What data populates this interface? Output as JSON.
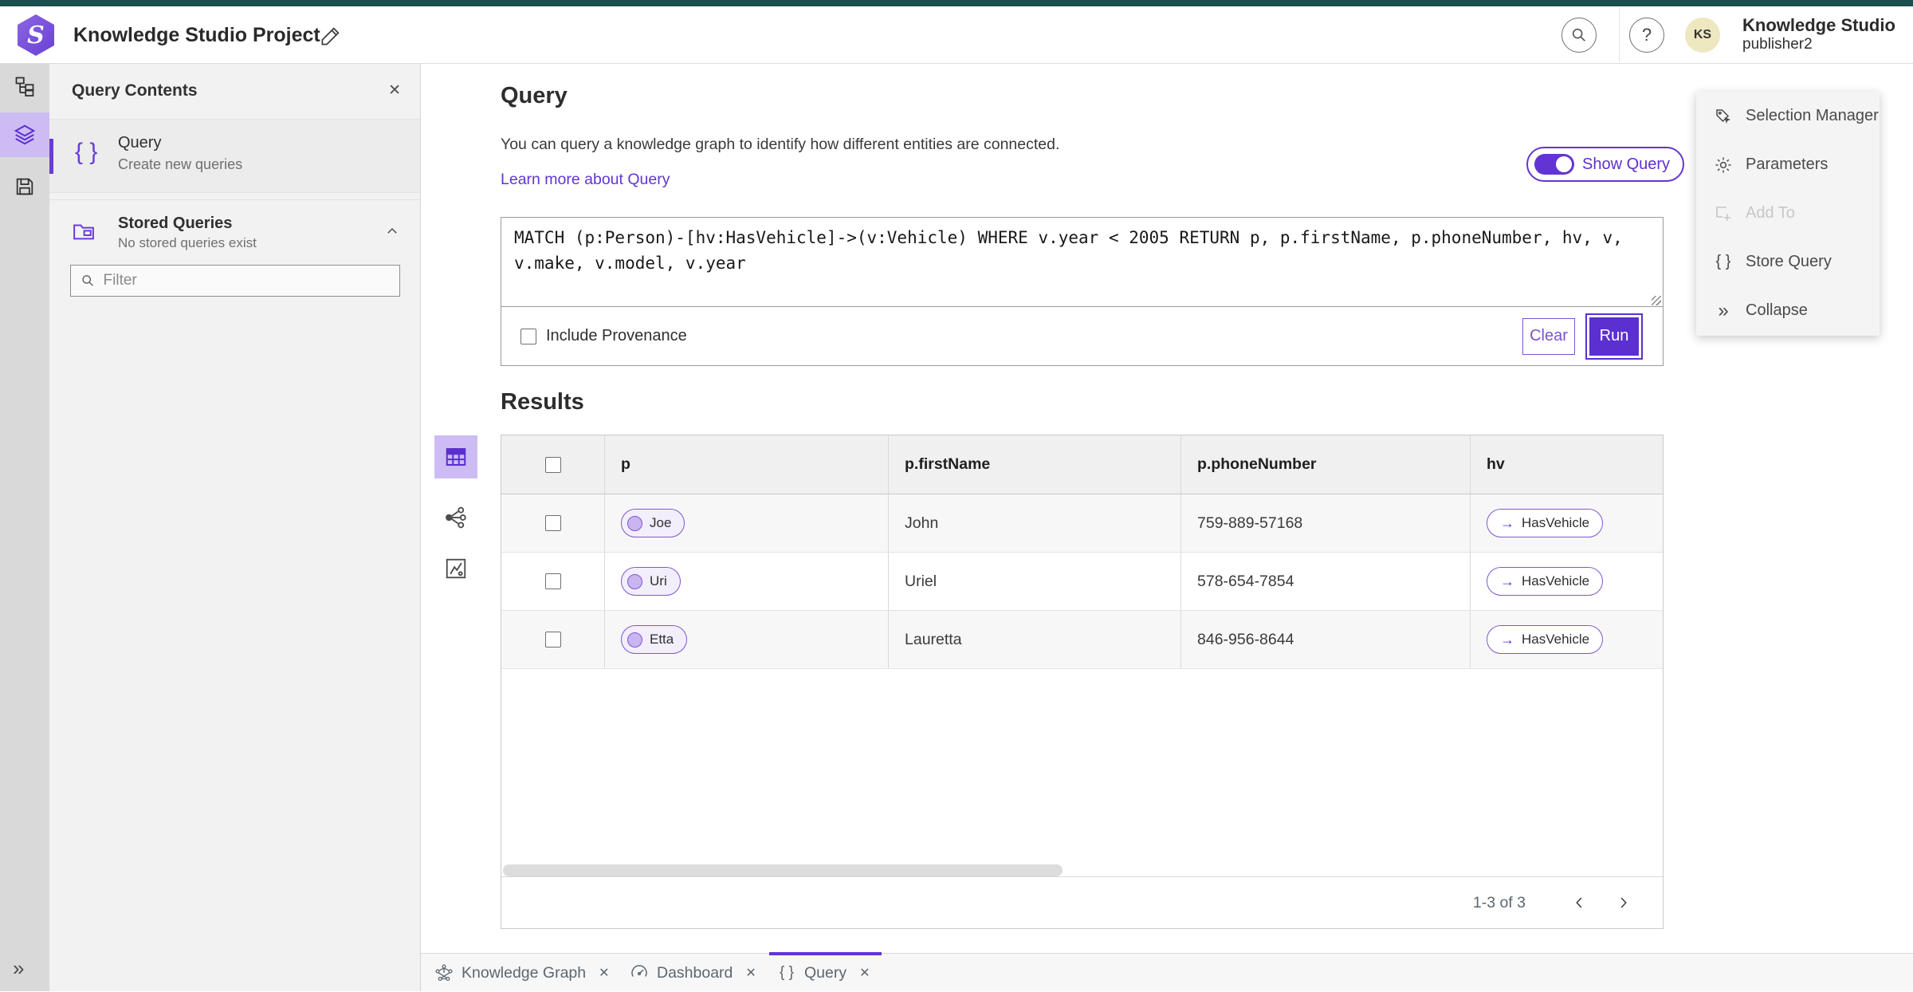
{
  "colors": {
    "accent_purple": "#5b2fd0",
    "accent_purple_light": "#cdbcf4",
    "teal_top_strip": "#1b4d51",
    "avatar_bg": "#eee8c0"
  },
  "topbar": {
    "title": "Knowledge Studio Project",
    "product": "Knowledge Studio",
    "user": "publisher2",
    "avatar_initials": "KS"
  },
  "panel": {
    "title": "Query Contents",
    "query_item": {
      "label": "Query",
      "description": "Create new queries"
    },
    "stored": {
      "label": "Stored Queries",
      "description": "No stored queries exist"
    },
    "filter_placeholder": "Filter"
  },
  "query": {
    "heading": "Query",
    "description": "You can query a knowledge graph to identify how different entities are connected.",
    "learn_more": "Learn more about Query",
    "show_query": "Show Query",
    "text": "MATCH (p:Person)-[hv:HasVehicle]->(v:Vehicle) WHERE v.year < 2005 RETURN p, p.firstName, p.phoneNumber, hv, v, v.make, v.model, v.year",
    "include_provenance": "Include Provenance",
    "clear": "Clear",
    "run": "Run"
  },
  "results": {
    "heading": "Results",
    "columns": [
      "p",
      "p.firstName",
      "p.phoneNumber",
      "hv"
    ],
    "rows": [
      {
        "entity": "Joe",
        "firstName": "John",
        "phone": "759-889-57168",
        "relation": "HasVehicle"
      },
      {
        "entity": "Uri",
        "firstName": "Uriel",
        "phone": "578-654-7854",
        "relation": "HasVehicle"
      },
      {
        "entity": "Etta",
        "firstName": "Lauretta",
        "phone": "846-956-8644",
        "relation": "HasVehicle"
      }
    ],
    "pagination": "1-3 of 3"
  },
  "side_menu": {
    "items": [
      {
        "label": "Selection Manager",
        "disabled": false
      },
      {
        "label": "Parameters",
        "disabled": false
      },
      {
        "label": "Add To",
        "disabled": true
      },
      {
        "label": "Store Query",
        "disabled": false
      },
      {
        "label": "Collapse",
        "disabled": false
      }
    ]
  },
  "tabs": [
    {
      "label": "Knowledge Graph",
      "active": false
    },
    {
      "label": "Dashboard",
      "active": false
    },
    {
      "label": "Query",
      "active": true
    }
  ],
  "icons": {
    "close": "✕",
    "braces": "{ }",
    "collapse_double": "»",
    "arrow_right": "→",
    "help": "?"
  }
}
